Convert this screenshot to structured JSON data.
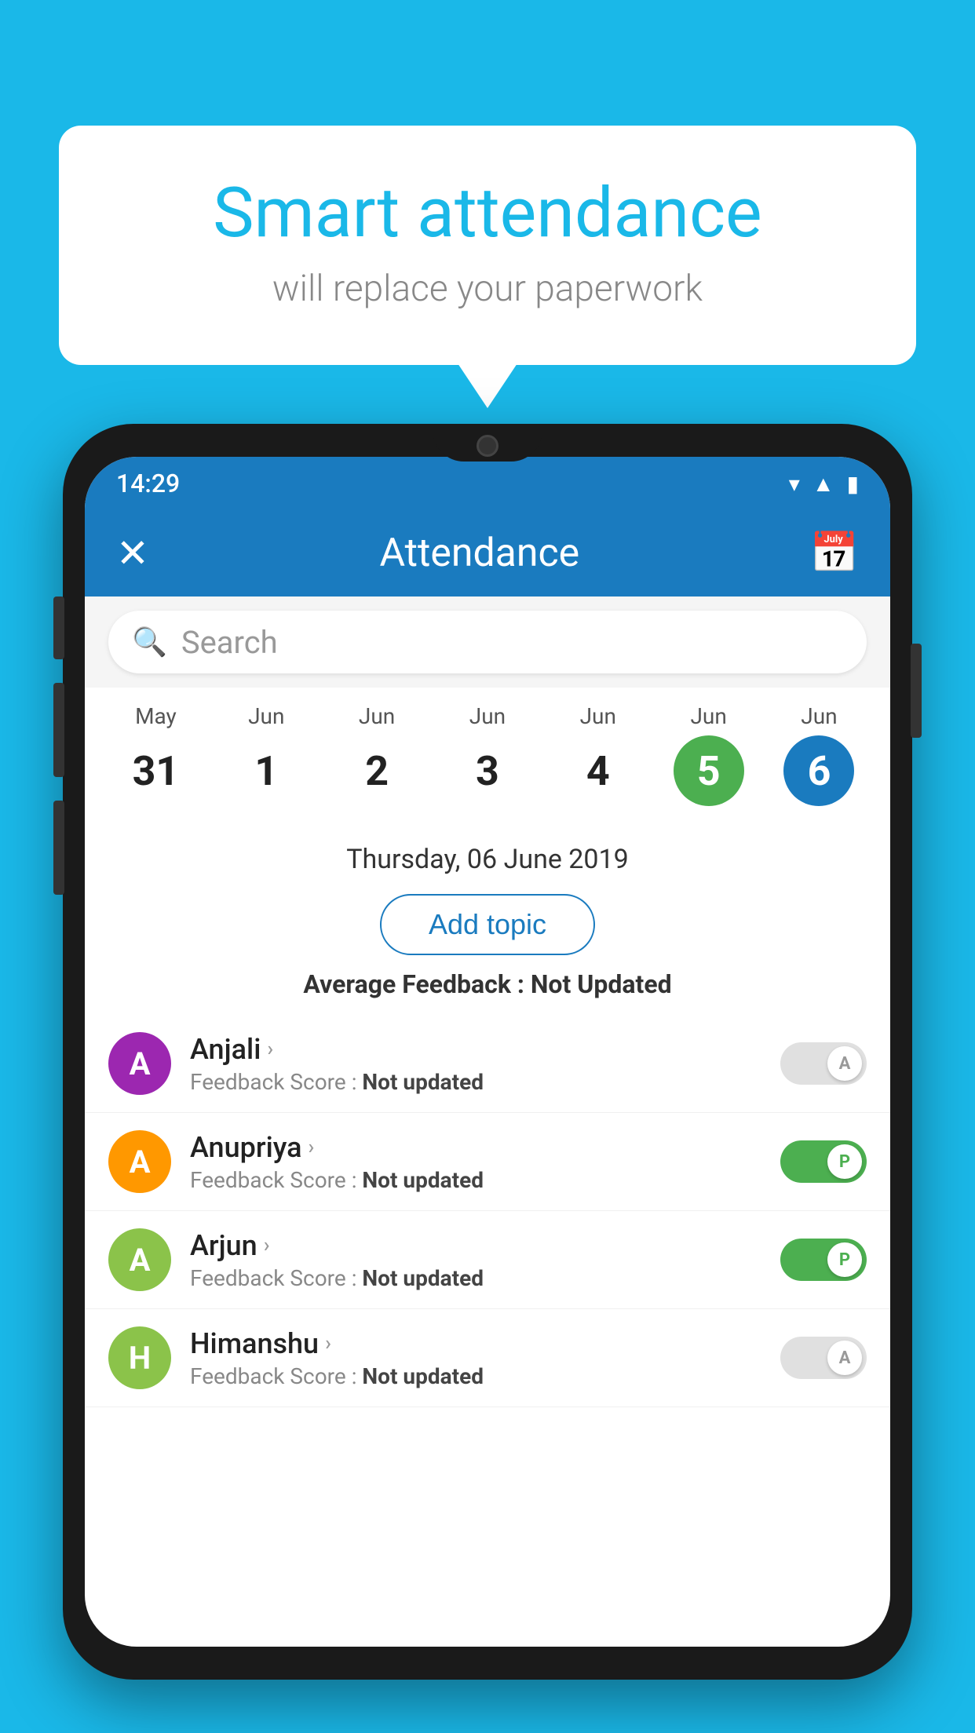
{
  "background_color": "#1ab8e8",
  "speech_bubble": {
    "title": "Smart attendance",
    "subtitle": "will replace your paperwork"
  },
  "status_bar": {
    "time": "14:29",
    "icons": [
      "wifi",
      "signal",
      "battery"
    ]
  },
  "app_bar": {
    "title": "Attendance",
    "close_label": "✕",
    "calendar_label": "📅"
  },
  "search": {
    "placeholder": "Search"
  },
  "calendar": {
    "days": [
      {
        "month": "May",
        "date": "31",
        "style": "normal"
      },
      {
        "month": "Jun",
        "date": "1",
        "style": "normal"
      },
      {
        "month": "Jun",
        "date": "2",
        "style": "normal"
      },
      {
        "month": "Jun",
        "date": "3",
        "style": "normal"
      },
      {
        "month": "Jun",
        "date": "4",
        "style": "normal"
      },
      {
        "month": "Jun",
        "date": "5",
        "style": "selected-green"
      },
      {
        "month": "Jun",
        "date": "6",
        "style": "selected-blue"
      }
    ],
    "selected_date": "Thursday, 06 June 2019"
  },
  "add_topic_button": "Add topic",
  "average_feedback": {
    "label": "Average Feedback : ",
    "value": "Not Updated"
  },
  "students": [
    {
      "name": "Anjali",
      "avatar_letter": "A",
      "avatar_color": "#9c27b0",
      "feedback_label": "Feedback Score : ",
      "feedback_value": "Not updated",
      "toggle_state": "off",
      "toggle_letter": "A"
    },
    {
      "name": "Anupriya",
      "avatar_letter": "A",
      "avatar_color": "#ff9800",
      "feedback_label": "Feedback Score : ",
      "feedback_value": "Not updated",
      "toggle_state": "on",
      "toggle_letter": "P"
    },
    {
      "name": "Arjun",
      "avatar_letter": "A",
      "avatar_color": "#8bc34a",
      "feedback_label": "Feedback Score : ",
      "feedback_value": "Not updated",
      "toggle_state": "on",
      "toggle_letter": "P"
    },
    {
      "name": "Himanshu",
      "avatar_letter": "H",
      "avatar_color": "#8bc34a",
      "feedback_label": "Feedback Score : ",
      "feedback_value": "Not updated",
      "toggle_state": "off",
      "toggle_letter": "A"
    }
  ]
}
